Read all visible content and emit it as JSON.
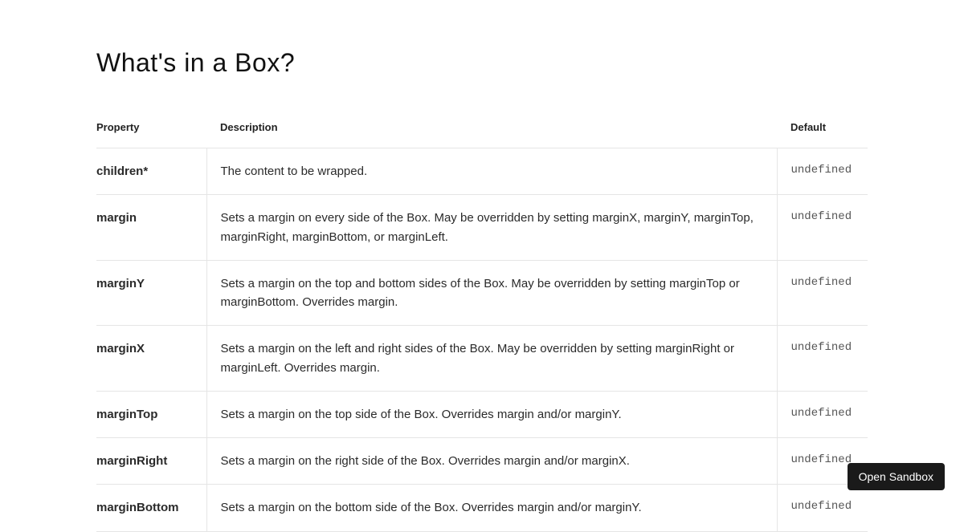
{
  "heading": "What's in a Box?",
  "columns": {
    "property": "Property",
    "description": "Description",
    "default": "Default"
  },
  "rows": [
    {
      "property": "children*",
      "description": "The content to be wrapped.",
      "default": "undefined"
    },
    {
      "property": "margin",
      "description": "Sets a margin on every side of the Box. May be overridden by setting marginX, marginY, marginTop, marginRight, marginBottom, or marginLeft.",
      "default": "undefined"
    },
    {
      "property": "marginY",
      "description": "Sets a margin on the top and bottom sides of the Box. May be overridden by setting marginTop or marginBottom. Overrides margin.",
      "default": "undefined"
    },
    {
      "property": "marginX",
      "description": "Sets a margin on the left and right sides of the Box. May be overridden by setting marginRight or marginLeft. Overrides margin.",
      "default": "undefined"
    },
    {
      "property": "marginTop",
      "description": "Sets a margin on the top side of the Box. Overrides margin and/or marginY.",
      "default": "undefined"
    },
    {
      "property": "marginRight",
      "description": "Sets a margin on the right side of the Box. Overrides margin and/or marginX.",
      "default": "undefined"
    },
    {
      "property": "marginBottom",
      "description": "Sets a margin on the bottom side of the Box. Overrides margin and/or marginY.",
      "default": "undefined"
    }
  ],
  "sandbox_button": "Open Sandbox"
}
